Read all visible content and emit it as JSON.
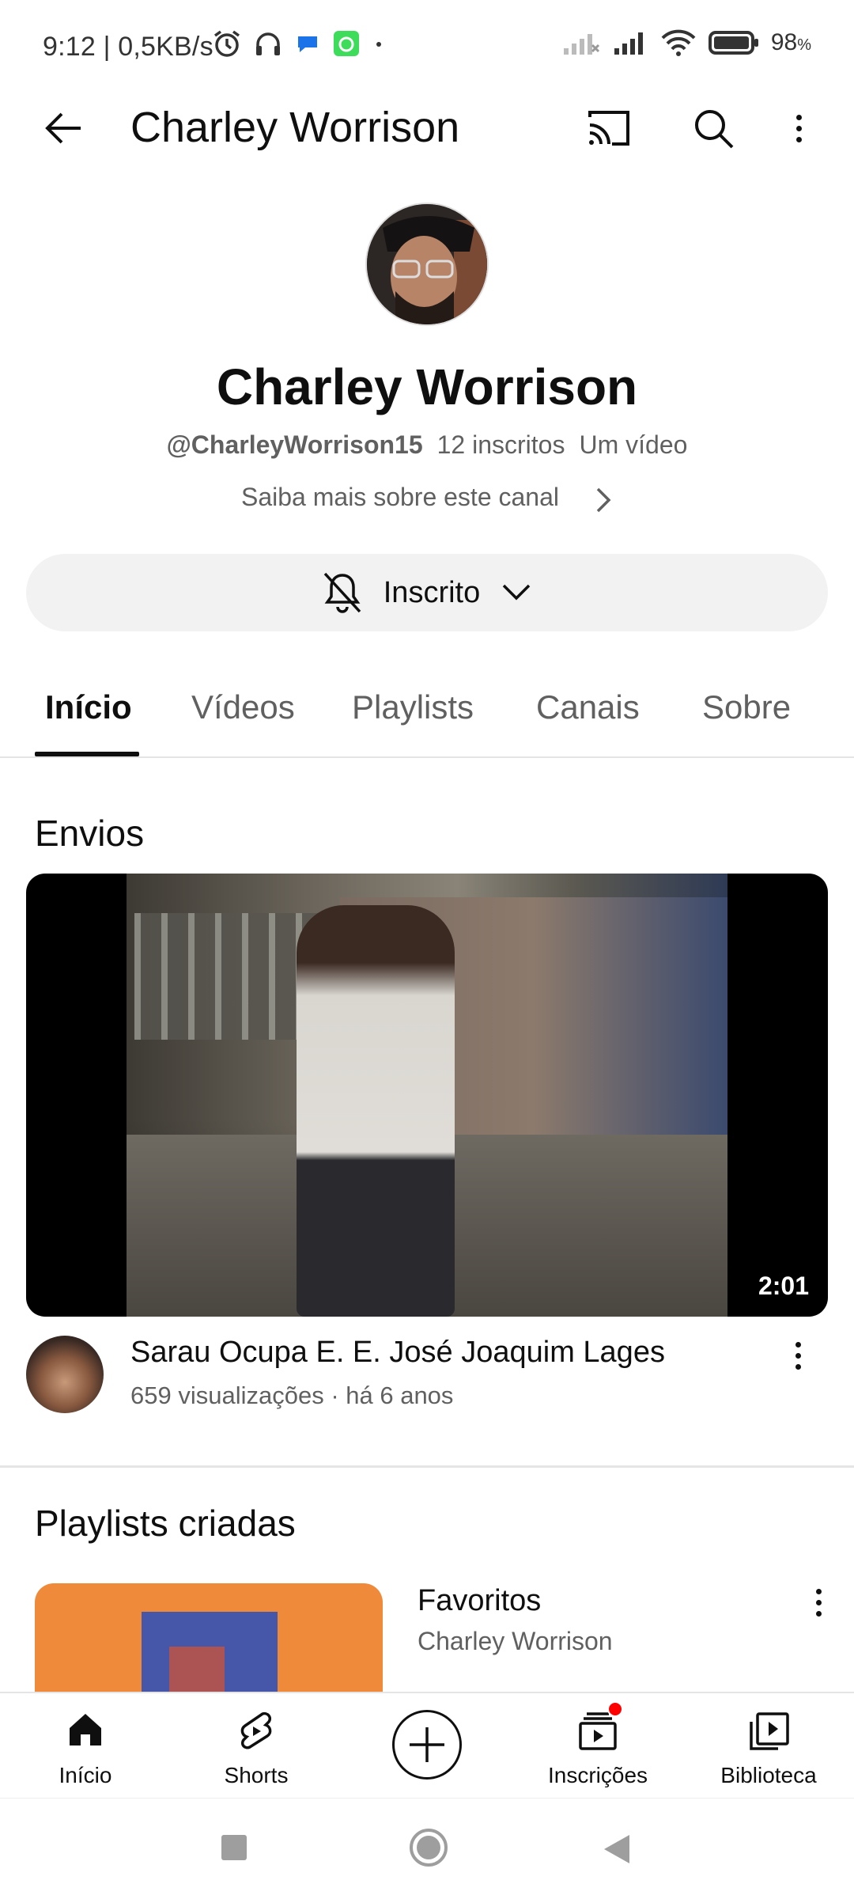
{
  "status_bar": {
    "time_speed": "9:12 | 0,5KB/s",
    "battery": "98",
    "battery_unit": "%",
    "icons_left": [
      "alarm-icon",
      "headphones-icon",
      "chat-icon",
      "app-icon"
    ],
    "icons_right": [
      "signal-icon",
      "signal-icon",
      "wifi-icon",
      "battery-icon"
    ]
  },
  "app_bar": {
    "title": "Charley Worrison",
    "actions": [
      "cast-icon",
      "search-icon",
      "more-icon"
    ]
  },
  "channel": {
    "name": "Charley Worrison",
    "handle": "@CharleyWorrison15",
    "subscribers": "12 inscritos",
    "videos": "Um vídeo",
    "more_info": "Saiba mais sobre este canal",
    "subscribe_label": "Inscrito"
  },
  "tabs": [
    {
      "label": "Início",
      "active": true
    },
    {
      "label": "Vídeos",
      "active": false
    },
    {
      "label": "Playlists",
      "active": false
    },
    {
      "label": "Canais",
      "active": false
    },
    {
      "label": "Sobre",
      "active": false
    }
  ],
  "uploads": {
    "section_title": "Envios",
    "video": {
      "title": "Sarau Ocupa E. E. José Joaquim Lages",
      "meta": "659 visualizações · há 6 anos",
      "duration": "2:01"
    }
  },
  "playlists": {
    "section_title": "Playlists criadas",
    "items": [
      {
        "title": "Favoritos",
        "owner": "Charley Worrison"
      }
    ]
  },
  "bottom_nav": [
    {
      "label": "Início",
      "icon": "home-icon"
    },
    {
      "label": "Shorts",
      "icon": "shorts-icon"
    },
    {
      "label": "",
      "icon": "create-icon"
    },
    {
      "label": "Inscrições",
      "icon": "subscriptions-icon"
    },
    {
      "label": "Biblioteca",
      "icon": "library-icon"
    }
  ],
  "colors": {
    "text_primary": "#0f0f0f",
    "text_secondary": "#606060",
    "pill_bg": "#f2f2f2",
    "notification_red": "#ff0000"
  }
}
